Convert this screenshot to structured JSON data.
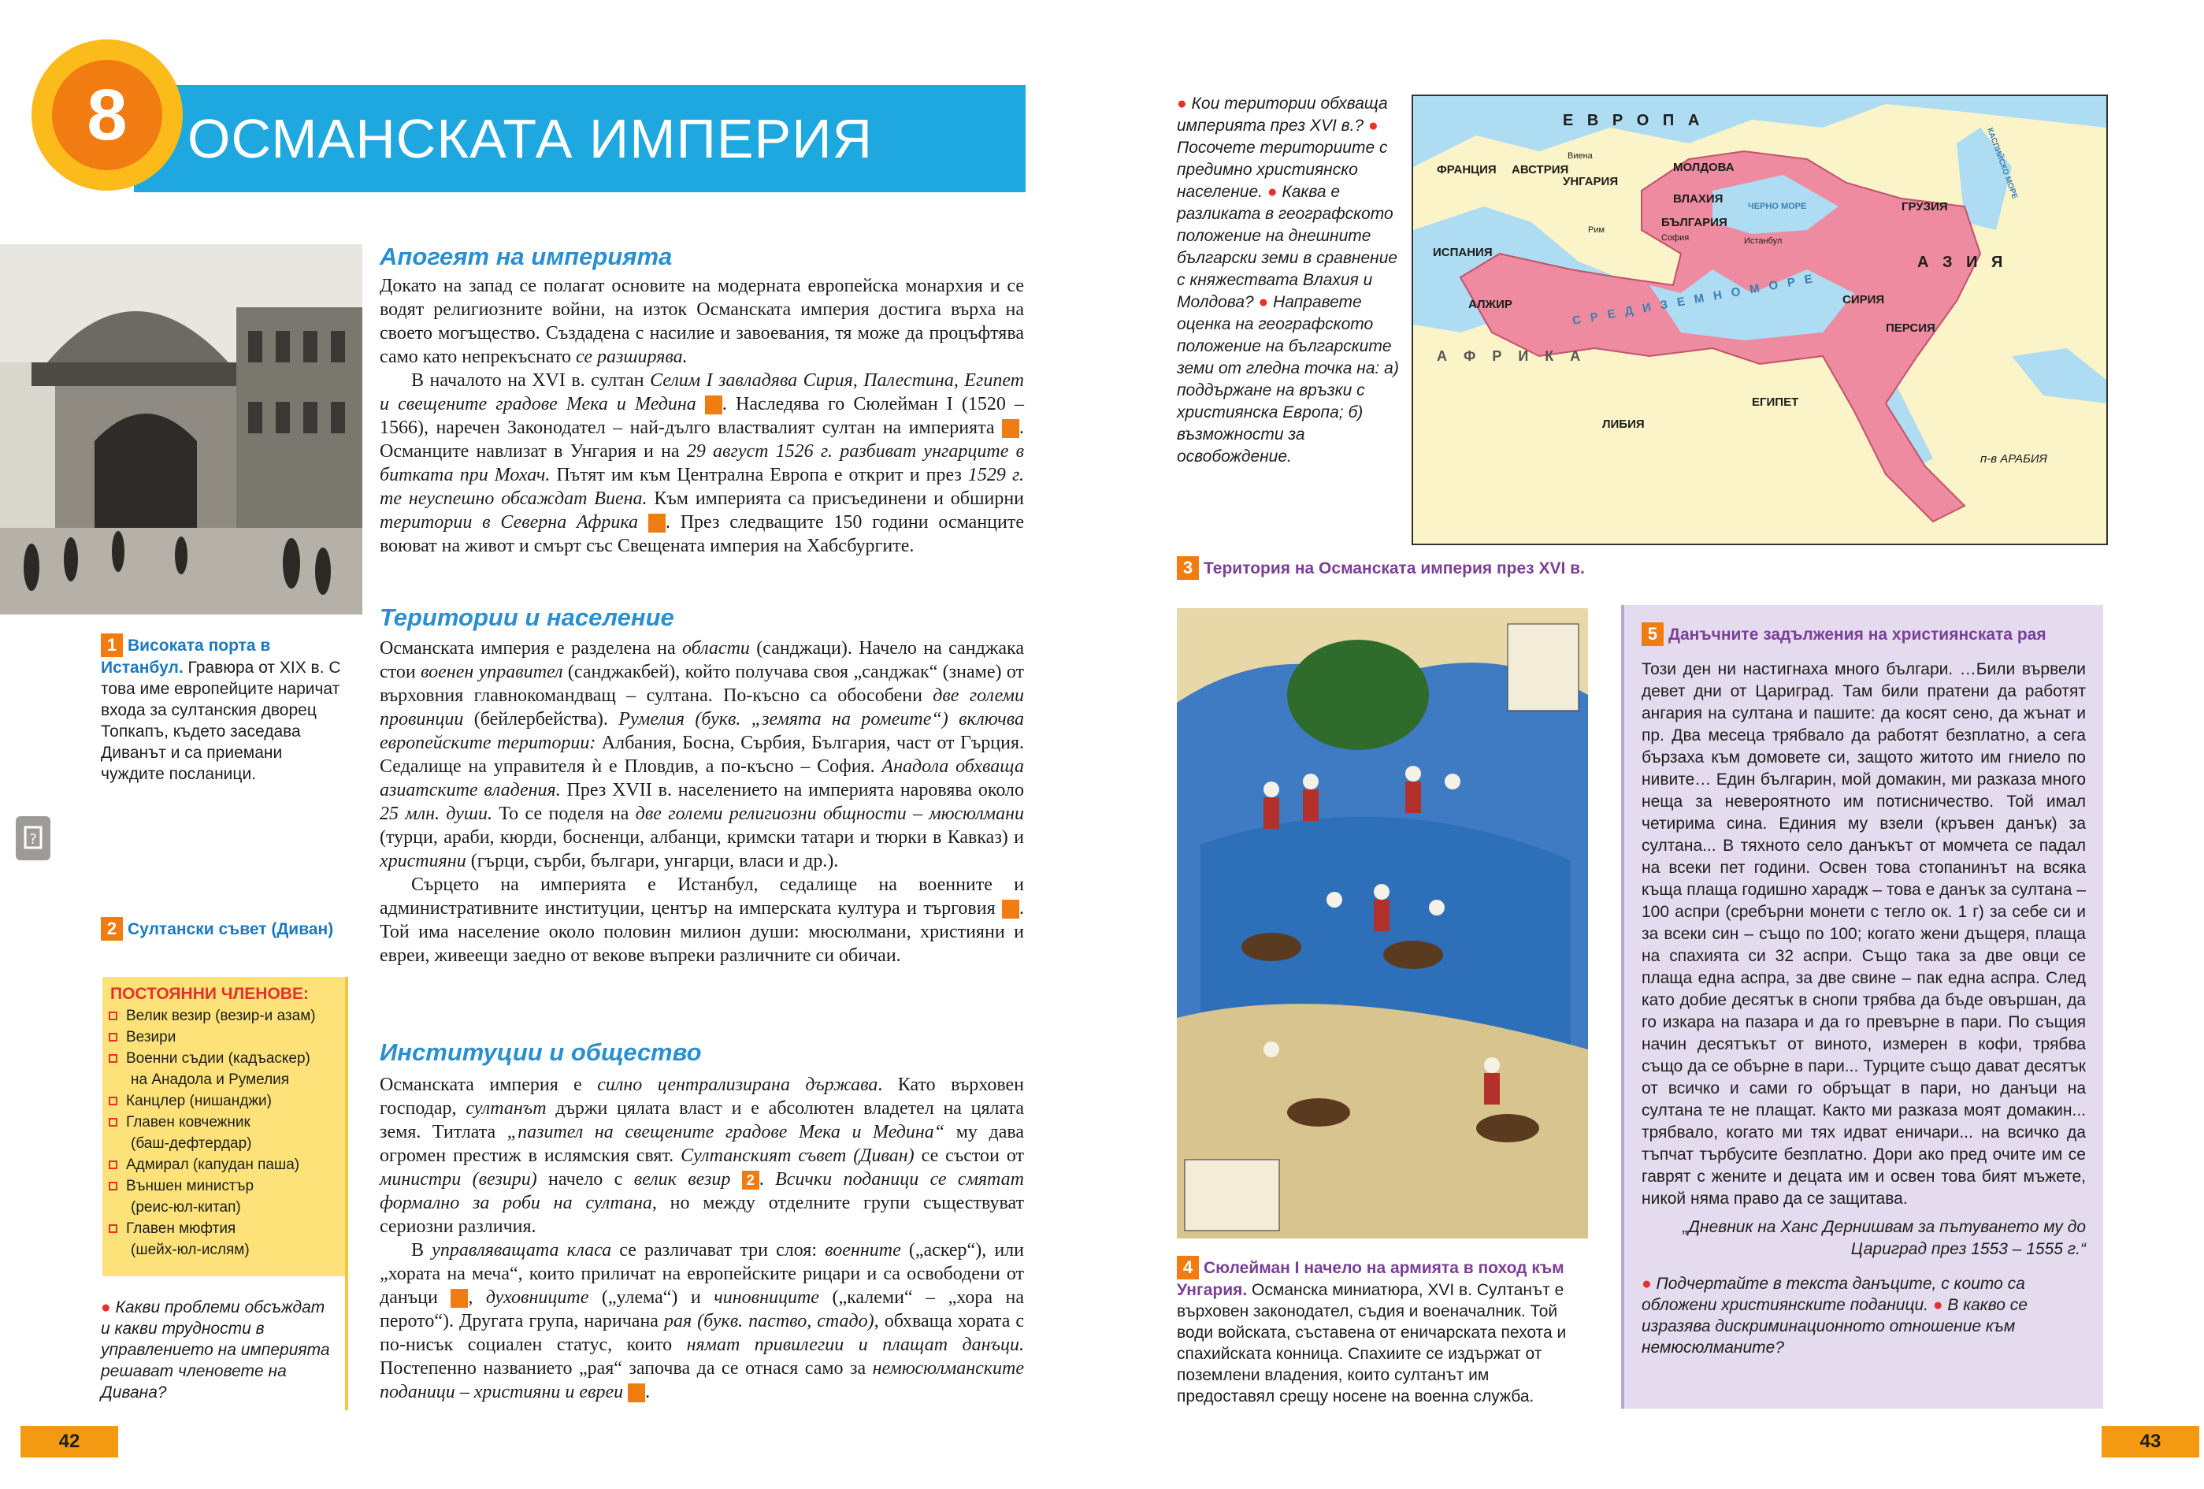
{
  "chapter": {
    "number": "8",
    "title": "ОСМАНСКАТА ИМПЕРИЯ"
  },
  "captions": {
    "c1": {
      "num": "1",
      "title": "Високата порта в Истанбул.",
      "text": "Гравюра от XIX в. С това име европейците наричат входа за султанския дворец Топкапъ, където заседава Диванът и са приемани чуждите посланици."
    },
    "c2": {
      "num": "2",
      "title": "Султански съвет (Диван)"
    },
    "c3": {
      "num": "3",
      "title": "Територия на Османската империя през XVI в."
    },
    "c4": {
      "num": "4",
      "title": "Сюлейман I начело на армията в поход към Унгария.",
      "text": "Османска миниатюра, XVI в. Султанът е върховен законодател, съдия и военачалник. Той води войската, съставена от еничарската пехота и спахийската конница. Спахиите се издържат от поземлени владения, които султанът им предоставял срещу носене на военна служба."
    },
    "c5": {
      "num": "5",
      "title": "Данъчните задължения на християнската рая"
    }
  },
  "divan": {
    "heading": "ПОСТОЯННИ ЧЛЕНОВЕ:",
    "items": [
      "Велик везир (везир-и азам)",
      "Везири",
      "Военни съдии (кадъаскер)",
      "на Анадола и Румелия",
      "Канцлер (нишанджи)",
      "Главен ковчежник",
      "(баш-дефтердар)",
      "Адмирал (капудан паша)",
      "Външен министър",
      "(реис-юл-китап)",
      "Главен мюфтия",
      "(шейх-юл-ислям)"
    ]
  },
  "questions": {
    "left": "Какви проблеми обсъждат и какви трудности в управлението на империята решават членовете на Дивана?",
    "map_q1": "Кои територии обхваща империята през XVI в.?",
    "map_q2": "Посочете териториите с предимно християнско население.",
    "map_q3": "Каква е разликата в географското положение на днешните български земи в сравнение с княжествата Влахия и Молдова?",
    "map_q4": "Направете оценка на географското положение на българските земи от гледна точка на: а) поддържане на връзки с християнска Европа; б) възможности за освобождение.",
    "tax_q1": "Подчертайте в текста данъците, с които са обложени християнските поданици.",
    "tax_q2": "В какво се изразява дискриминационното отношение към немюсюлманите?"
  },
  "sections": {
    "s1_title": "Апогеят на империята",
    "s2_title": "Територии и население",
    "s3_title": "Институции и общество"
  },
  "tax_source": {
    "text": "Този ден ни настигнаха много българи. …Били вървели девет дни от Цариград. Там били пратени да работят ангария на султана и пашите: да косят сено, да жънат и пр. Два месеца трябвало да работят безплатно, а сега бързаха към домовете си, защото житото им гниело по нивите… Един българин, мой домакин, ми разказа много неща за невероятното им потисничество. Той имал четирима сина. Единия му взели (кръвен данък) за султана... В тяхното село данъкът от момчета се падал на всеки пет години. Освен това стопанинът на всяка къща плаща годишно харадж – това е данък за султана – 100 аспри (сребърни монети с тегло ок. 1 г) за себе си и за всеки син – също по 100; когато жени дъщеря, плаща на спахията си 32 аспри. Също така за две овци се плаща една аспра, за две свине – пак една аспра. След като добие десятък в снопи трябва да бъде овършан, да го изкара на пазара и да го превърне в пари. По същия начин десятъкът от виното, измерен в кофи, трябва също да се обърне в пари... Турците също дават десятък от всичко и сами го обръщат в пари, но данъци на султана те не плащат. Както ми разказа моят домакин... трябвало, когато ми тях идват еничари... на всичко да тъпчат търбусите безплатно. Дори ако пред очите им се гаврят с жените и децата им и освен това бият мъжете, никой няма право да се защитава.",
    "citation": "„Дневник на Ханс Дернишвам за пътуването му до Цариград през 1553 – 1555 г.“"
  },
  "map_labels": {
    "europe": "Е В Р О П А",
    "asia": "А З И Я",
    "africa": "А Ф Р И К А",
    "sea": "С Р Е Д И З Е М Н О М О Р Е",
    "black_sea": "ЧЕРНО МОРЕ",
    "caspian": "КАСПИЙСКО МОРЕ",
    "france": "ФРАНЦИЯ",
    "austria": "АВСТРИЯ",
    "hungary": "УНГАРИЯ",
    "vienna": "Виена",
    "moldova": "МОЛДОВА",
    "wallachia": "ВЛАХИЯ",
    "bulgaria": "БЪЛГАРИЯ",
    "sofia": "София",
    "istanbul": "Истанбул",
    "rome": "Рим",
    "georgia": "ГРУЗИЯ",
    "spain": "ИСПАНИЯ",
    "algeria": "АЛЖИР",
    "libya": "ЛИБИЯ",
    "egypt": "ЕГИПЕТ",
    "syria": "СИРИЯ",
    "persia": "ПЕРСИЯ",
    "arabia": "п-в АРАБИЯ"
  },
  "page_numbers": {
    "left": "42",
    "right": "43"
  },
  "colors": {
    "header_blue": "#1fa8e0",
    "accent_orange": "#f07c12",
    "badge_yellow": "#fbbb1a",
    "empire_pink": "#ee8ba0",
    "divan_yellow": "#fde27a",
    "source_lilac": "#e4dbef"
  }
}
